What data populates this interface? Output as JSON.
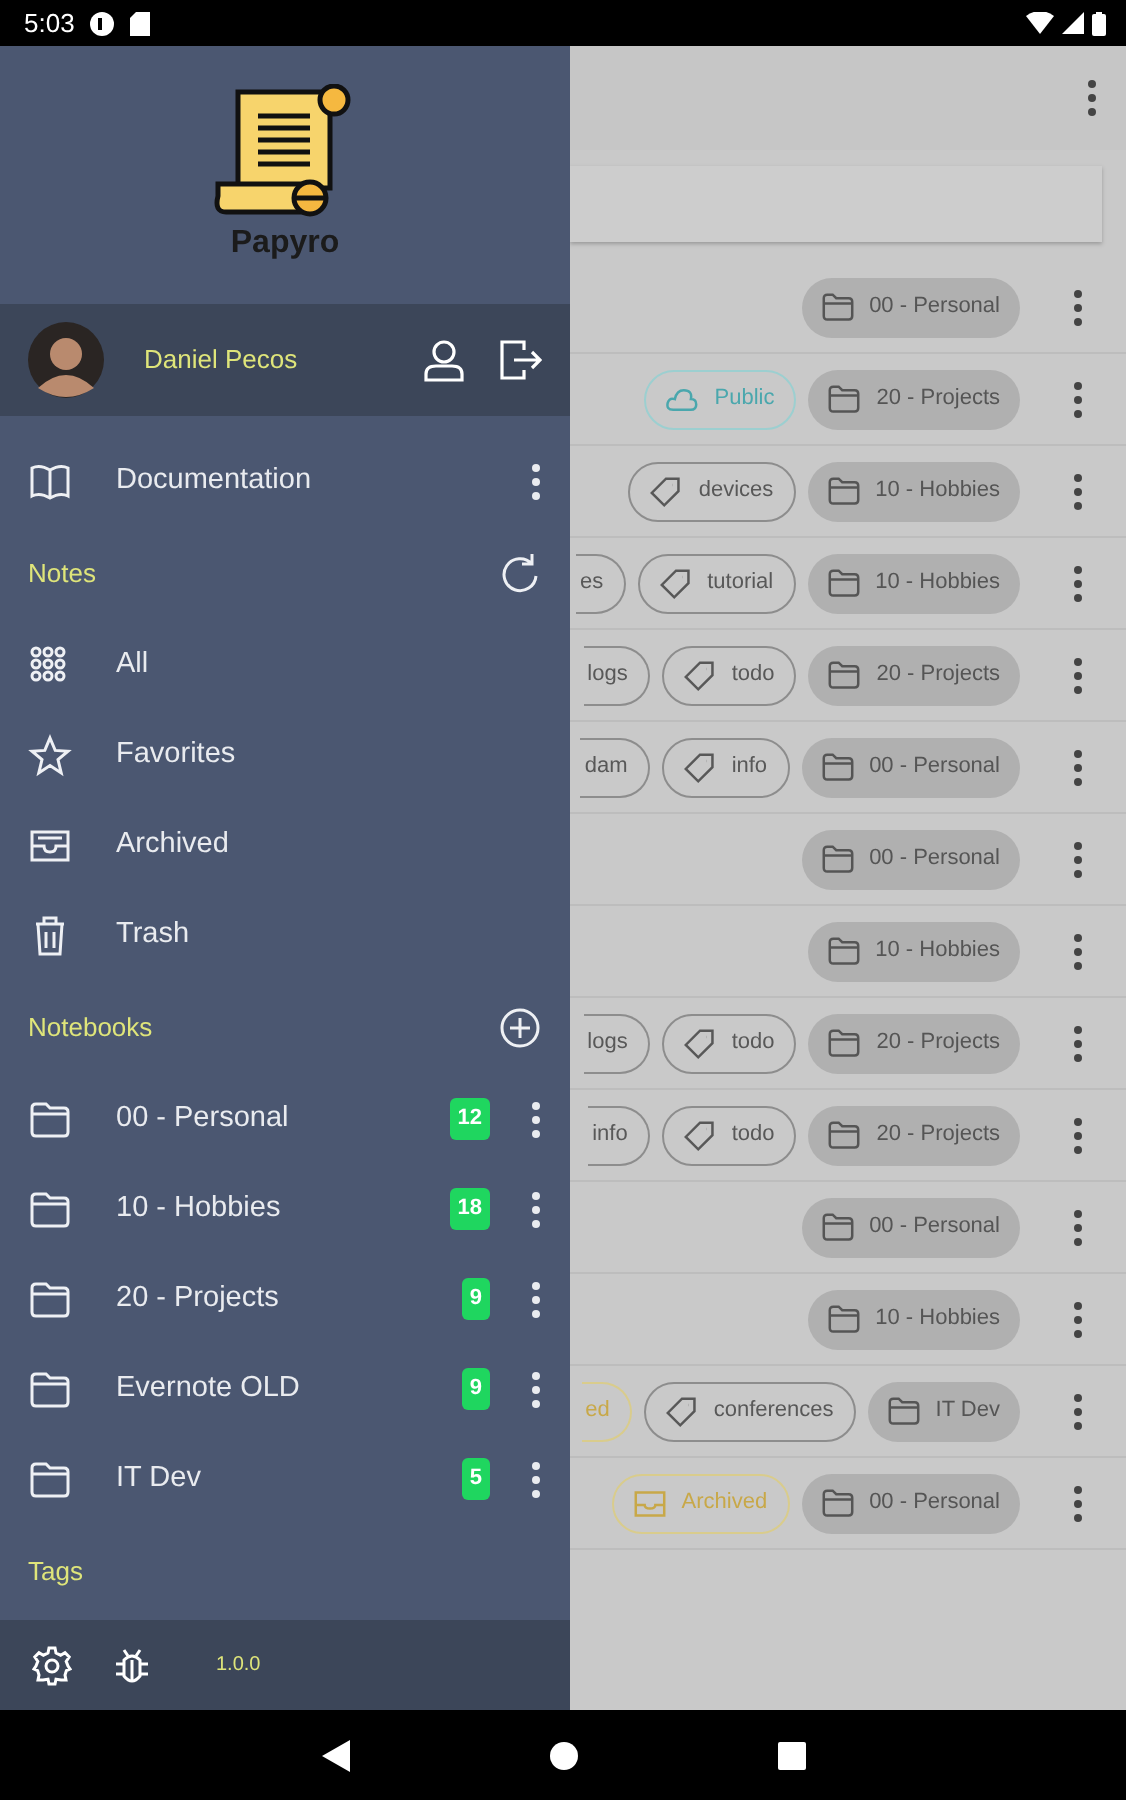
{
  "status_bar": {
    "time": "5:03"
  },
  "drawer": {
    "app_name": "Papyro",
    "user": {
      "name": "Daniel Pecos"
    },
    "top_items": [
      {
        "kind": "documentation",
        "label": "Documentation"
      }
    ],
    "sections": [
      {
        "kind": "notes",
        "title": "Notes",
        "items": [
          {
            "kind": "all",
            "label": "All"
          },
          {
            "kind": "favorites",
            "label": "Favorites"
          },
          {
            "kind": "archived",
            "label": "Archived"
          },
          {
            "kind": "trash",
            "label": "Trash"
          }
        ]
      },
      {
        "kind": "notebooks",
        "title": "Notebooks",
        "items": [
          {
            "kind": "notebook",
            "label": "00 - Personal",
            "count": "12"
          },
          {
            "kind": "notebook",
            "label": "10 - Hobbies",
            "count": "18"
          },
          {
            "kind": "notebook",
            "label": "20 - Projects",
            "count": "9"
          },
          {
            "kind": "notebook",
            "label": "Evernote OLD",
            "count": "9"
          },
          {
            "kind": "notebook",
            "label": "IT Dev",
            "count": "5"
          }
        ]
      },
      {
        "kind": "tags",
        "title": "Tags"
      }
    ],
    "footer": {
      "version": "1.0.0"
    }
  },
  "notes": {
    "rows": [
      {
        "chips": [
          {
            "kind": "folder",
            "label": "00 - Personal"
          }
        ]
      },
      {
        "chips": [
          {
            "kind": "public",
            "label": "Public"
          },
          {
            "kind": "folder",
            "label": "20 - Projects"
          }
        ]
      },
      {
        "chips": [
          {
            "kind": "tag",
            "label": "devices"
          },
          {
            "kind": "folder",
            "label": "10 - Hobbies"
          }
        ]
      },
      {
        "chips": [
          {
            "kind": "tag",
            "label": "es",
            "clipped": true
          },
          {
            "kind": "tag",
            "label": "tutorial"
          },
          {
            "kind": "folder",
            "label": "10 - Hobbies"
          }
        ]
      },
      {
        "chips": [
          {
            "kind": "tag",
            "label": "logs",
            "clipped": true
          },
          {
            "kind": "tag",
            "label": "todo"
          },
          {
            "kind": "folder",
            "label": "20 - Projects"
          }
        ]
      },
      {
        "chips": [
          {
            "kind": "tag",
            "label": "dam",
            "clipped": true
          },
          {
            "kind": "tag",
            "label": "info"
          },
          {
            "kind": "folder",
            "label": "00 - Personal"
          }
        ]
      },
      {
        "chips": [
          {
            "kind": "folder",
            "label": "00 - Personal"
          }
        ]
      },
      {
        "chips": [
          {
            "kind": "folder",
            "label": "10 - Hobbies"
          }
        ]
      },
      {
        "chips": [
          {
            "kind": "tag",
            "label": "logs",
            "clipped": true
          },
          {
            "kind": "tag",
            "label": "todo"
          },
          {
            "kind": "folder",
            "label": "20 - Projects"
          }
        ]
      },
      {
        "chips": [
          {
            "kind": "tag",
            "label": "info",
            "clipped": true
          },
          {
            "kind": "tag",
            "label": "todo"
          },
          {
            "kind": "folder",
            "label": "20 - Projects"
          }
        ]
      },
      {
        "chips": [
          {
            "kind": "folder",
            "label": "00 - Personal"
          }
        ]
      },
      {
        "chips": [
          {
            "kind": "folder",
            "label": "10 - Hobbies"
          }
        ]
      },
      {
        "chips": [
          {
            "kind": "archived",
            "label": "ed",
            "clipped": true
          },
          {
            "kind": "tag",
            "label": "conferences"
          },
          {
            "kind": "folder",
            "label": "IT Dev"
          }
        ]
      },
      {
        "chips": [
          {
            "kind": "archived",
            "label": "Archived"
          },
          {
            "kind": "folder",
            "label": "00 - Personal"
          }
        ]
      }
    ]
  }
}
